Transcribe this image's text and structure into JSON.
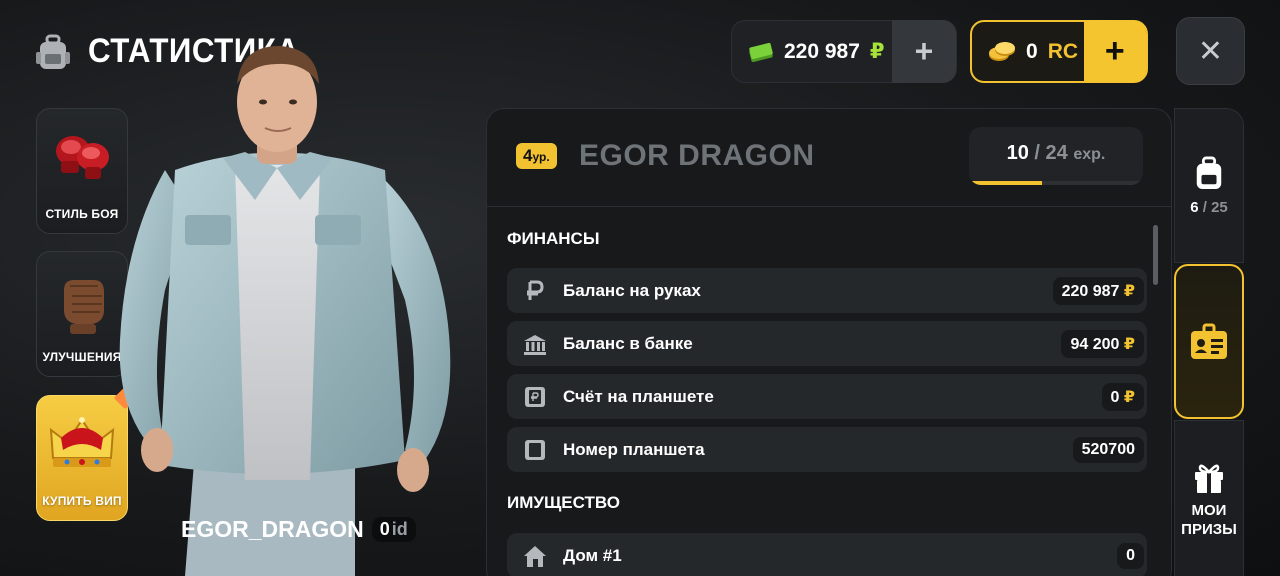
{
  "header": {
    "title": "СТАТИСТИКА"
  },
  "side_menu": [
    {
      "label": "СТИЛЬ БОЯ"
    },
    {
      "label": "УЛУЧШЕНИЯ"
    },
    {
      "label": "КУПИТЬ ВИП"
    }
  ],
  "player": {
    "name": "EGOR_DRAGON",
    "id": "0",
    "id_suffix": "id"
  },
  "currency": {
    "money": "220 987",
    "money_symbol": "₽",
    "rc": "0",
    "rc_symbol": "RC",
    "plus_label": "+"
  },
  "close_label": "✕",
  "stats": {
    "level": "4",
    "level_suffix": "ур.",
    "nickname": "EGOR DRAGON",
    "exp_current": "10",
    "exp_separator": "/",
    "exp_total": "24",
    "exp_unit": "exp.",
    "exp_progress": 0.4167
  },
  "finances": {
    "title": "ФИНАНСЫ",
    "rows": [
      {
        "label": "Баланс на руках",
        "value": "220 987",
        "currency": "₽"
      },
      {
        "label": "Баланс в банке",
        "value": "94 200",
        "currency": "₽"
      },
      {
        "label": "Счёт на планшете",
        "value": "0",
        "currency": "₽"
      },
      {
        "label": "Номер планшета",
        "value": "520700",
        "currency": ""
      }
    ]
  },
  "property": {
    "title": "ИМУЩЕСТВО",
    "rows": [
      {
        "label": "Дом #1",
        "value": "0"
      }
    ]
  },
  "right_tabs": {
    "inventory_count": "6",
    "inventory_sep": "/",
    "inventory_max": "25",
    "prizes_label_1": "МОИ",
    "prizes_label_2": "ПРИЗЫ"
  },
  "colors": {
    "accent": "#f2c230",
    "money_green": "#a7e23a"
  }
}
